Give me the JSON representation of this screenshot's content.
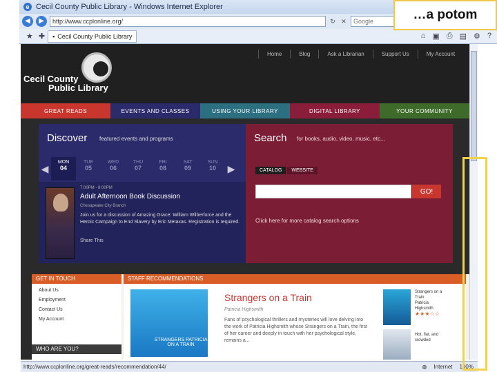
{
  "window": {
    "title": "Cecil County Public Library - Windows Internet Explorer",
    "url": "http://www.ccplonline.org/",
    "search_placeholder": "Google",
    "tab_label": "Cecil County Public Library"
  },
  "overlay": {
    "label": "…a potom"
  },
  "header": {
    "logo_line1": "Cecil County",
    "logo_line2": "Public Library",
    "topnav": [
      "Home",
      "Blog",
      "Ask a Librarian",
      "Support Us",
      "My Account"
    ]
  },
  "mainnav": [
    {
      "label": "GREAT READS",
      "color": "#c8362e"
    },
    {
      "label": "EVENTS AND CLASSES",
      "color": "#2b2b6b"
    },
    {
      "label": "USING YOUR LIBRARY",
      "color": "#2c6f80"
    },
    {
      "label": "DIGITAL LIBRARY",
      "color": "#8a1d3a"
    },
    {
      "label": "YOUR COMMUNITY",
      "color": "#3f6b2a"
    }
  ],
  "discover": {
    "title": "Discover",
    "subtitle": "featured events and programs",
    "days": [
      {
        "dow": "MON",
        "num": "04"
      },
      {
        "dow": "TUE",
        "num": "05"
      },
      {
        "dow": "WED",
        "num": "06"
      },
      {
        "dow": "THU",
        "num": "07"
      },
      {
        "dow": "FRI",
        "num": "08"
      },
      {
        "dow": "SAT",
        "num": "09"
      },
      {
        "dow": "SUN",
        "num": "10"
      }
    ],
    "event": {
      "date": "7:00PM - 8:00PM",
      "title": "Adult Afternoon Book Discussion",
      "place": "Chesapeake City Branch",
      "desc": "Join us for a discussion of Amazing Grace: William Wilberforce and the Heroic Campaign to End Slavery by Eric Metaxas. Registration is required.",
      "share": "Share This"
    }
  },
  "search": {
    "title": "Search",
    "subtitle": "for books, audio, video, music, etc...",
    "tabs": [
      "CATALOG",
      "WEBSITE"
    ],
    "go_label": "GO!",
    "hint": "Click here for more catalog search options"
  },
  "getintouch": {
    "header": "GET IN TOUCH",
    "links": [
      "About Us",
      "Employment",
      "Contact Us",
      "My Account"
    ],
    "who_header": "WHO ARE YOU?"
  },
  "staff": {
    "header": "STAFF RECOMMENDATIONS",
    "cover_text": "STRANGERS PATRICIA ON A TRAIN",
    "rec_title": "Strangers on a Train",
    "rec_author": "Patricia Highsmith",
    "rec_desc": "Fans of psychological thrillers and mysteries will love delving into the work of Patricia Highsmith whose Strangers on a Train, the first of her career and deeply in touch with her psychological style, remains a...",
    "side1": [
      "Strangers on a",
      "Train",
      "Patricia",
      "Highsmith"
    ],
    "side2": [
      "Hot, flat, and",
      "crowded"
    ]
  },
  "statusbar": {
    "url": "http://www.ccplonline.org/great-reads/recommendation/44/",
    "zone": "Internet",
    "zoom": "100%"
  }
}
